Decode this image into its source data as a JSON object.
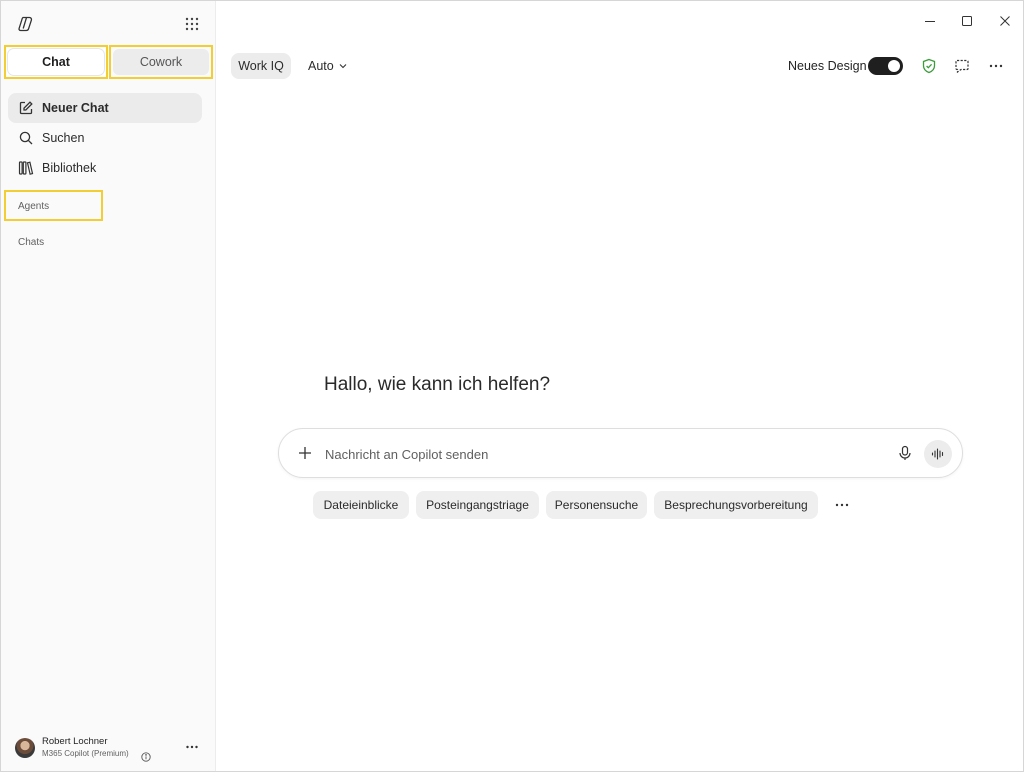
{
  "sidebar": {
    "tabs": {
      "chat": "Chat",
      "cowork": "Cowork"
    },
    "nav": {
      "new_chat": "Neuer Chat",
      "search": "Suchen",
      "library": "Bibliothek"
    },
    "sections": {
      "agents": "Agents",
      "chats": "Chats"
    },
    "profile": {
      "name": "Robert Lochner",
      "plan": "M365 Copilot (Premium)"
    }
  },
  "header": {
    "work_iq": "Work IQ",
    "model": "Auto",
    "design_label": "Neues Design",
    "design_toggle_on": true
  },
  "main": {
    "greeting": "Hallo, wie kann ich helfen?",
    "composer_placeholder": "Nachricht an Copilot senden",
    "suggestions": [
      "Dateieinblicke",
      "Posteingangstriage",
      "Personensuche",
      "Besprechungsvorbereitung"
    ]
  },
  "colors": {
    "highlight": "#f2cd33",
    "shield": "#3a9d3a",
    "toggle": "#1f1f1f"
  }
}
